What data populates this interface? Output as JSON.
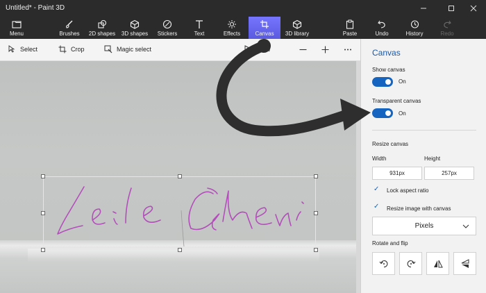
{
  "window": {
    "title": "Untitled* - Paint 3D"
  },
  "ribbon": {
    "menu": "Menu",
    "brushes": "Brushes",
    "shapes2d": "2D shapes",
    "shapes3d": "3D shapes",
    "stickers": "Stickers",
    "text": "Text",
    "effects": "Effects",
    "canvas": "Canvas",
    "library3d": "3D library",
    "paste": "Paste",
    "undo": "Undo",
    "history": "History",
    "redo": "Redo"
  },
  "toolbar": {
    "select": "Select",
    "crop": "Crop",
    "magic_select": "Magic select",
    "view": "View"
  },
  "panel": {
    "title": "Canvas",
    "show_canvas_label": "Show canvas",
    "show_canvas_state": "On",
    "transparent_label": "Transparent canvas",
    "transparent_state": "On",
    "resize_label": "Resize canvas",
    "width_label": "Width",
    "height_label": "Height",
    "width_value": "931px",
    "height_value": "257px",
    "lock_aspect": "Lock aspect ratio",
    "resize_with_canvas": "Resize image with canvas",
    "units": "Pixels",
    "rotate_flip_label": "Rotate and flip"
  },
  "colors": {
    "accent": "#1565c0",
    "canvas_tab": "#6d6df0",
    "signature": "#b03ab8"
  }
}
